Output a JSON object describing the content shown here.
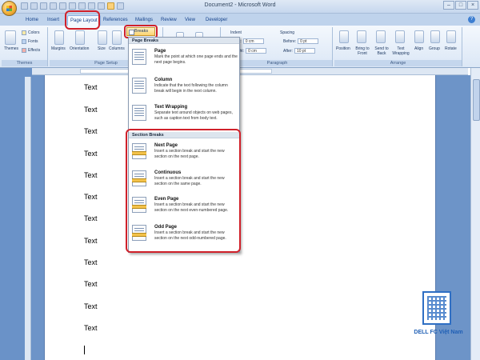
{
  "window": {
    "title": "Document2 - Microsoft Word",
    "controls": [
      "–",
      "□",
      "×"
    ]
  },
  "tabs": [
    "Home",
    "Insert",
    "Page Layout",
    "References",
    "Mailings",
    "Review",
    "View",
    "Developer"
  ],
  "active_tab": "Page Layout",
  "ribbon": {
    "themes": {
      "label": "Themes",
      "colors": "Colors",
      "fonts": "Fonts",
      "effects": "Effects",
      "group_label": "Themes"
    },
    "page_setup": {
      "margins": "Margins",
      "orientation": "Orientation",
      "size": "Size",
      "columns": "Columns",
      "breaks": "Breaks",
      "group_label": "Page Setup"
    },
    "paragraph": {
      "indent": "Indent",
      "left": "Left:",
      "right": "Right:",
      "left_value": "0 cm",
      "right_value": "0 cm",
      "spacing": "Spacing",
      "before": "Before:",
      "after": "After:",
      "before_value": "0 pt",
      "after_value": "10 pt",
      "group_label": "Paragraph"
    },
    "arrange": {
      "position": "Position",
      "bring_to_front": "Bring to Front",
      "send_to_back": "Send to Back",
      "text_wrapping": "Text Wrapping",
      "align": "Align",
      "group": "Group",
      "rotate": "Rotate",
      "group_label": "Arrange"
    }
  },
  "breaks_menu": {
    "page_breaks_header": "Page Breaks",
    "page_breaks": [
      {
        "title": "Page",
        "desc": "Mark the point at which one page ends and the next page begins."
      },
      {
        "title": "Column",
        "desc": "Indicate that the text following the column break will begin in the next column."
      },
      {
        "title": "Text Wrapping",
        "desc": "Separate text around objects on web pages, such as caption text from body text."
      }
    ],
    "section_breaks_header": "Section Breaks",
    "section_breaks": [
      {
        "title": "Next Page",
        "desc": "Insert a section break and start the new section on the next page."
      },
      {
        "title": "Continuous",
        "desc": "Insert a section break and start the new section on the same page."
      },
      {
        "title": "Even Page",
        "desc": "Insert a section break and start the new section on the next even-numbered page."
      },
      {
        "title": "Odd Page",
        "desc": "Insert a section break and start the new section on the next odd-numbered page."
      }
    ]
  },
  "document": {
    "lines": [
      "Text",
      "Text",
      "Text",
      "Text",
      "Text",
      "Text",
      "Text",
      "Text",
      "Text",
      "Text",
      "Text",
      "Text"
    ]
  },
  "watermark": "DELL FC Việt Nam",
  "colors": {
    "highlight": "#d0202a",
    "ribbon": "#dbe7f6",
    "workspace": "#6d94c8"
  }
}
